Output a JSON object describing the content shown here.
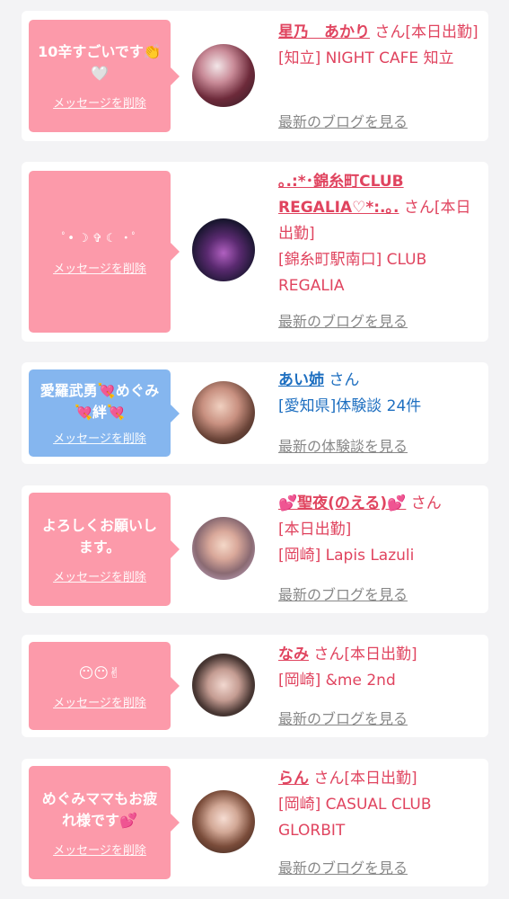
{
  "items": [
    {
      "message": "10辛すごいです👏🤍",
      "delete_label": "メッセージを削除",
      "name": "星乃　あかり",
      "suffix": "さん",
      "status": "[本日出勤]",
      "location": "[知立] NIGHT CAFE 知立",
      "link": "最新のブログを見る"
    },
    {
      "message": "ﾟ• ☽ ✞ ☾ •ﾟ",
      "delete_label": "メッセージを削除",
      "name": "｡.:*･錦糸町CLUB REGALIA♡*:.｡.",
      "suffix": "さん",
      "status": "[本日出勤]",
      "location": "[錦糸町駅南口] CLUB REGALIA",
      "link": "最新のブログを見る"
    },
    {
      "message": "愛羅武勇💘めぐみ💘絆💘",
      "delete_label": "メッセージを削除",
      "name": "あい姉",
      "suffix": "さん",
      "status": "",
      "location": "[愛知県]体験談 24件",
      "link": "最新の体験談を見る"
    },
    {
      "message": "よろしくお願いします。",
      "delete_label": "メッセージを削除",
      "name": "💕聖夜(のえる)💕",
      "suffix": "さん",
      "status": "[本日出勤]",
      "location": "[岡崎] Lapis Lazuli",
      "link": "最新のブログを見る"
    },
    {
      "message": "😶😶✌",
      "delete_label": "メッセージを削除",
      "name": "なみ",
      "suffix": "さん",
      "status": "[本日出勤]",
      "location": "[岡崎] &me 2nd",
      "link": "最新のブログを見る"
    },
    {
      "message": "めぐみママもお疲れ様です💕",
      "delete_label": "メッセージを削除",
      "name": "らん",
      "suffix": "さん",
      "status": "[本日出勤]",
      "location": "[岡崎] CASUAL CLUB GLORBIT",
      "link": "最新のブログを見る"
    }
  ],
  "colors": {
    "pink_bubble": "#fc9aaa",
    "blue_bubble": "#85b6ef",
    "pink_text": "#e0445f",
    "blue_text": "#1e6fc0",
    "link_gray": "#888888"
  }
}
